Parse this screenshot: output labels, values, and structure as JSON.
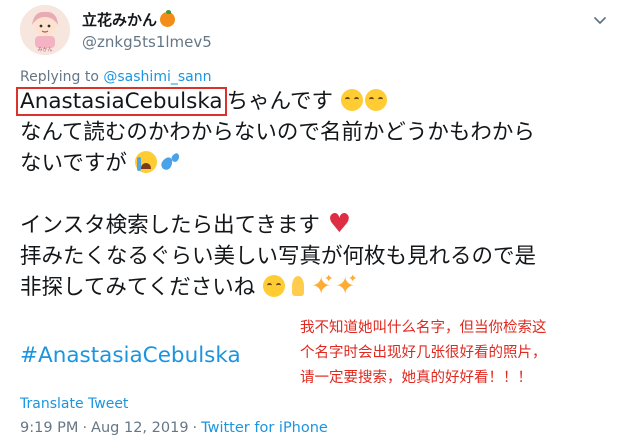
{
  "author": {
    "display_name": "立花みかん",
    "handle": "@znkg5ts1lmev5",
    "avatar_caption": "みかん"
  },
  "reply": {
    "prefix": "Replying to ",
    "mention": "@sashimi_sann"
  },
  "tweet": {
    "line1_name": "AnastasiaCebulska",
    "line1_rest": "ちゃんです",
    "line2": "なんて読むのかわからないので名前かどうかもわから",
    "line3": "ないですが",
    "line4": "インスタ検索したら出てきます",
    "line5": "拝みたくなるぐらい美しい写真が何枚も見れるので是",
    "line6": "非探してみてくださいね",
    "hashtag": "#AnastasiaCebulska"
  },
  "annotation": {
    "line1": "我不知道她叫什么名字，但当你检索这",
    "line2": "个名字时会出现好几张很好看的照片，",
    "line3": "请一定要搜索，她真的好好看！！！"
  },
  "actions": {
    "translate": "Translate Tweet"
  },
  "meta": {
    "time": "9:19 PM",
    "separator": "·",
    "date": "Aug 12, 2019",
    "source": "Twitter for iPhone"
  },
  "icons": {
    "menu": "chevron-down-icon",
    "badge": "orange-emoji-icon",
    "emoji_thinking": "pleading-face-icon",
    "emoji_cry": "loudly-crying-face-icon",
    "emoji_sweat": "sweat-droplets-icon",
    "emoji_heart": "red-heart-icon",
    "emoji_pray": "folded-hands-icon",
    "emoji_sparkles": "sparkles-icon"
  },
  "colors": {
    "link": "#1b95e0",
    "muted": "#657786",
    "annotation": "#e0281f",
    "highlight_box": "#d9342b"
  }
}
